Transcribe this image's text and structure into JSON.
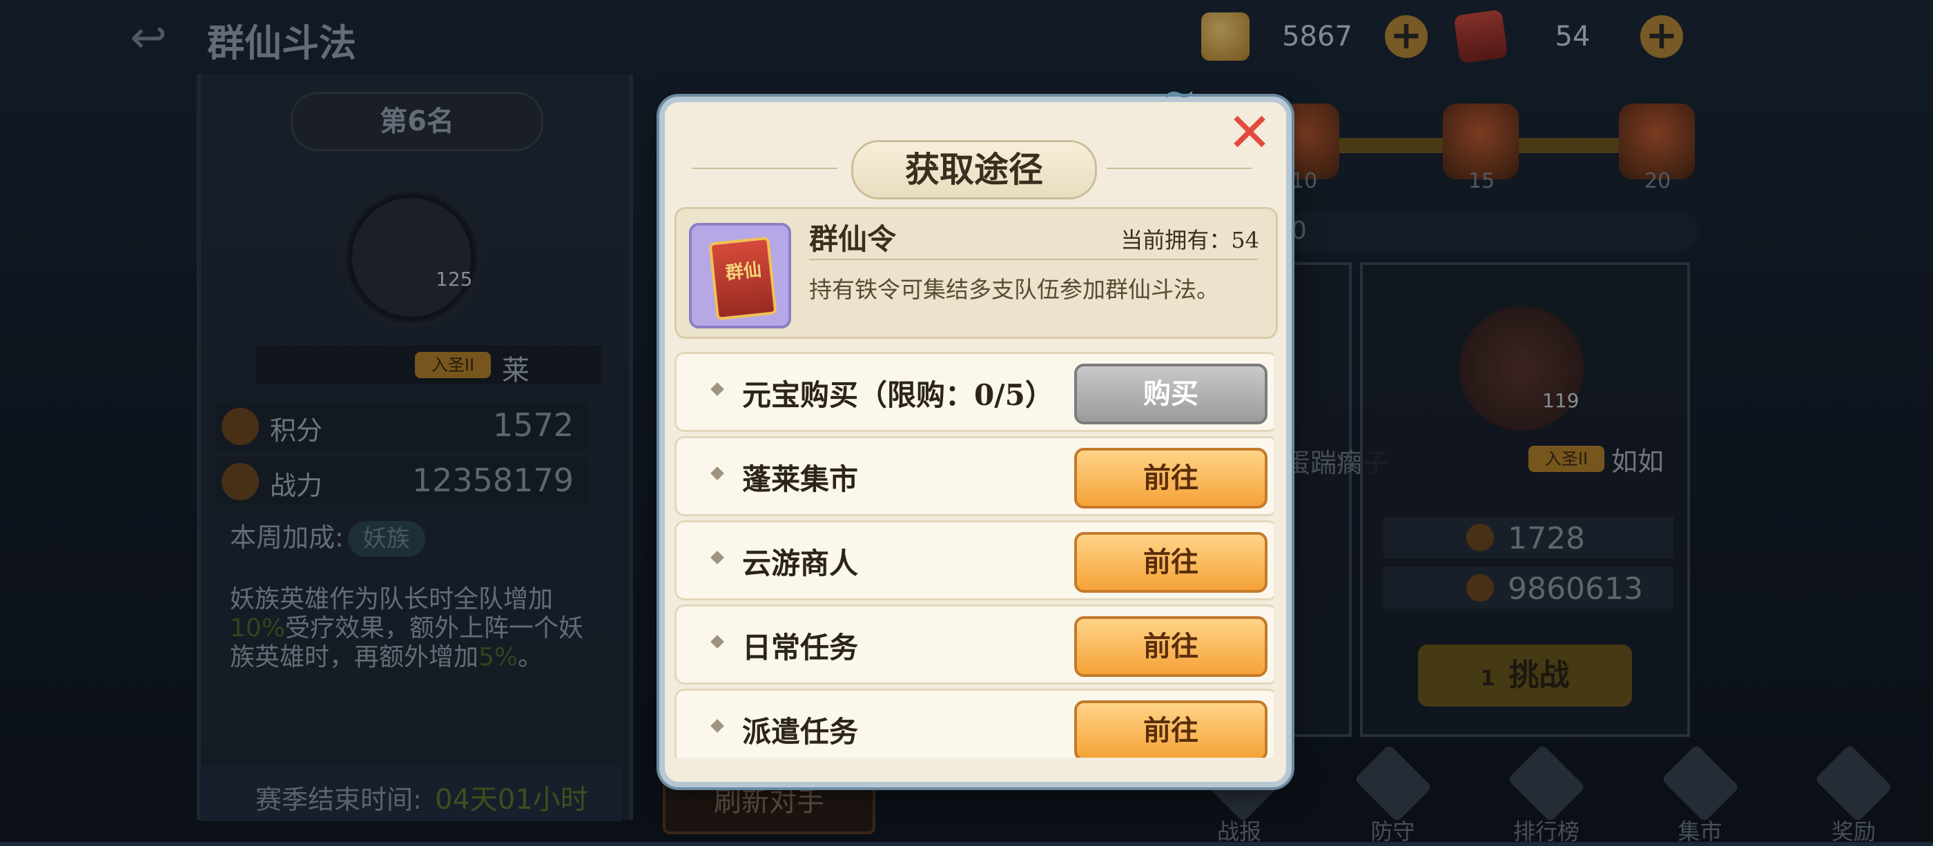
{
  "top": {
    "title": "群仙斗法",
    "back_glyph": "↩",
    "ingot_value": "5867",
    "token_value": "54",
    "plus_glyph": "+"
  },
  "left_panel": {
    "rank": "第6名",
    "avatar_level": "125",
    "badge": "入圣II",
    "player_name": "莱",
    "score_label": "积分",
    "score_value": "1572",
    "power_label": "战力",
    "power_value": "12358179",
    "week_bonus_label": "本周加成:",
    "week_bonus_pill": "妖族",
    "desc_a": "妖族英雄作为队长时全队增加",
    "desc_pct1": "10%",
    "desc_b": "受疗效果，额外上阵一个妖族英雄时，再额外增加",
    "desc_pct2": "5%",
    "desc_c": "。",
    "season_label": "赛季结束时间:",
    "season_value": "04天01小时",
    "refresh_button": "刷新对手"
  },
  "right_panel": {
    "chest_counts": [
      "10",
      "15",
      "20"
    ],
    "score_strip": "0",
    "ghost_name": "蛋踹瘸子",
    "opponent_level": "119",
    "opponent_badge": "入圣II",
    "opponent_name": "如如",
    "opponent_score": "1728",
    "opponent_power": "9860613",
    "fight_button": "挑战",
    "fight_cost": "1"
  },
  "bottom_nav": [
    "战报",
    "防守",
    "排行榜",
    "集市",
    "奖励"
  ],
  "modal": {
    "title": "获取途径",
    "close_glyph": "✕",
    "item": {
      "name": "群仙令",
      "owned": "当前拥有：54",
      "desc": "持有铁令可集结多支队伍参加群仙斗法。",
      "icon_text": "群仙"
    },
    "routes": [
      {
        "label": "元宝购买（限购：0/5）",
        "button": "购买",
        "style": "gray"
      },
      {
        "label": "蓬莱集市",
        "button": "前往",
        "style": "orange"
      },
      {
        "label": "云游商人",
        "button": "前往",
        "style": "orange"
      },
      {
        "label": "日常任务",
        "button": "前往",
        "style": "orange"
      },
      {
        "label": "派遣任务",
        "button": "前往",
        "style": "orange"
      }
    ]
  },
  "colors": {
    "orange_button": "#f5a238",
    "gray_button": "#9b9b9b",
    "close_red": "#e24a3c",
    "modal_bg": "#f3ecdc"
  }
}
